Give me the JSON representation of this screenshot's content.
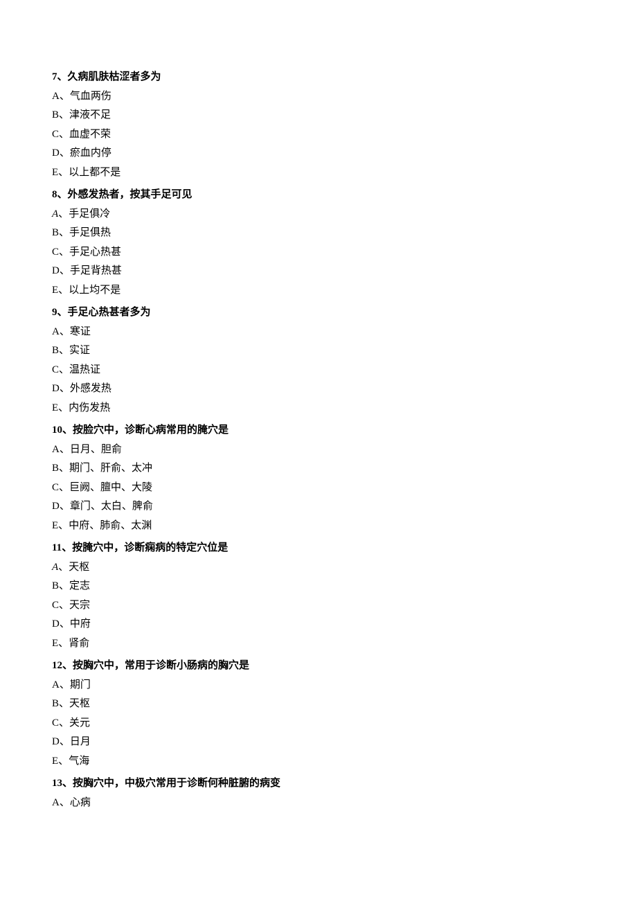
{
  "questions": [
    {
      "number": "7",
      "stem": "久病肌肤枯涩者多为",
      "options": [
        {
          "letter": "A",
          "text": "气血两伤"
        },
        {
          "letter": "B",
          "text": "津液不足"
        },
        {
          "letter": "C",
          "text": "血虚不荣"
        },
        {
          "letter": "D",
          "text": "瘀血内停"
        },
        {
          "letter": "E",
          "text": "以上都不是"
        }
      ]
    },
    {
      "number": "8",
      "stem": "外感发热者，按其手足可见",
      "options": [
        {
          "letter": "A",
          "text": "手足俱冷",
          "italic_letter": true
        },
        {
          "letter": "B",
          "text": "手足俱热"
        },
        {
          "letter": "C",
          "text": "手足心热甚"
        },
        {
          "letter": "D",
          "text": "手足背热甚"
        },
        {
          "letter": "E",
          "text": "以上均不是"
        }
      ]
    },
    {
      "number": "9",
      "stem": "手足心热甚者多为",
      "options": [
        {
          "letter": "A",
          "text": "寒证"
        },
        {
          "letter": "B",
          "text": "实证"
        },
        {
          "letter": "C",
          "text": "温热证"
        },
        {
          "letter": "D",
          "text": "外感发热"
        },
        {
          "letter": "E",
          "text": "内伤发热"
        }
      ]
    },
    {
      "number": "10",
      "stem": "按脸穴中，诊断心病常用的腌穴是",
      "options": [
        {
          "letter": "A",
          "text": "日月、胆俞"
        },
        {
          "letter": "B",
          "text": "期门、肝俞、太冲"
        },
        {
          "letter": "C",
          "text": "巨阙、膻中、大陵"
        },
        {
          "letter": "D",
          "text": "章门、太白、脾俞"
        },
        {
          "letter": "E",
          "text": "中府、肺俞、太渊"
        }
      ]
    },
    {
      "number": "11",
      "stem": "按腌穴中，诊断痫病的特定穴位是",
      "options": [
        {
          "letter": "A",
          "text": "天枢",
          "italic_letter": true
        },
        {
          "letter": "B",
          "text": "定志"
        },
        {
          "letter": "C",
          "text": "天宗"
        },
        {
          "letter": "D",
          "text": "中府"
        },
        {
          "letter": "E",
          "text": "肾俞"
        }
      ]
    },
    {
      "number": "12",
      "stem": "按胸穴中，常用于诊断小肠病的胸穴是",
      "options": [
        {
          "letter": "A",
          "text": "期门"
        },
        {
          "letter": "B",
          "text": "天枢"
        },
        {
          "letter": "C",
          "text": "关元"
        },
        {
          "letter": "D",
          "text": "日月"
        },
        {
          "letter": "E",
          "text": "气海"
        }
      ]
    },
    {
      "number": "13",
      "stem": "按胸穴中，中极穴常用于诊断何种脏腑的病变",
      "options": [
        {
          "letter": "A",
          "text": "心病"
        }
      ]
    }
  ]
}
